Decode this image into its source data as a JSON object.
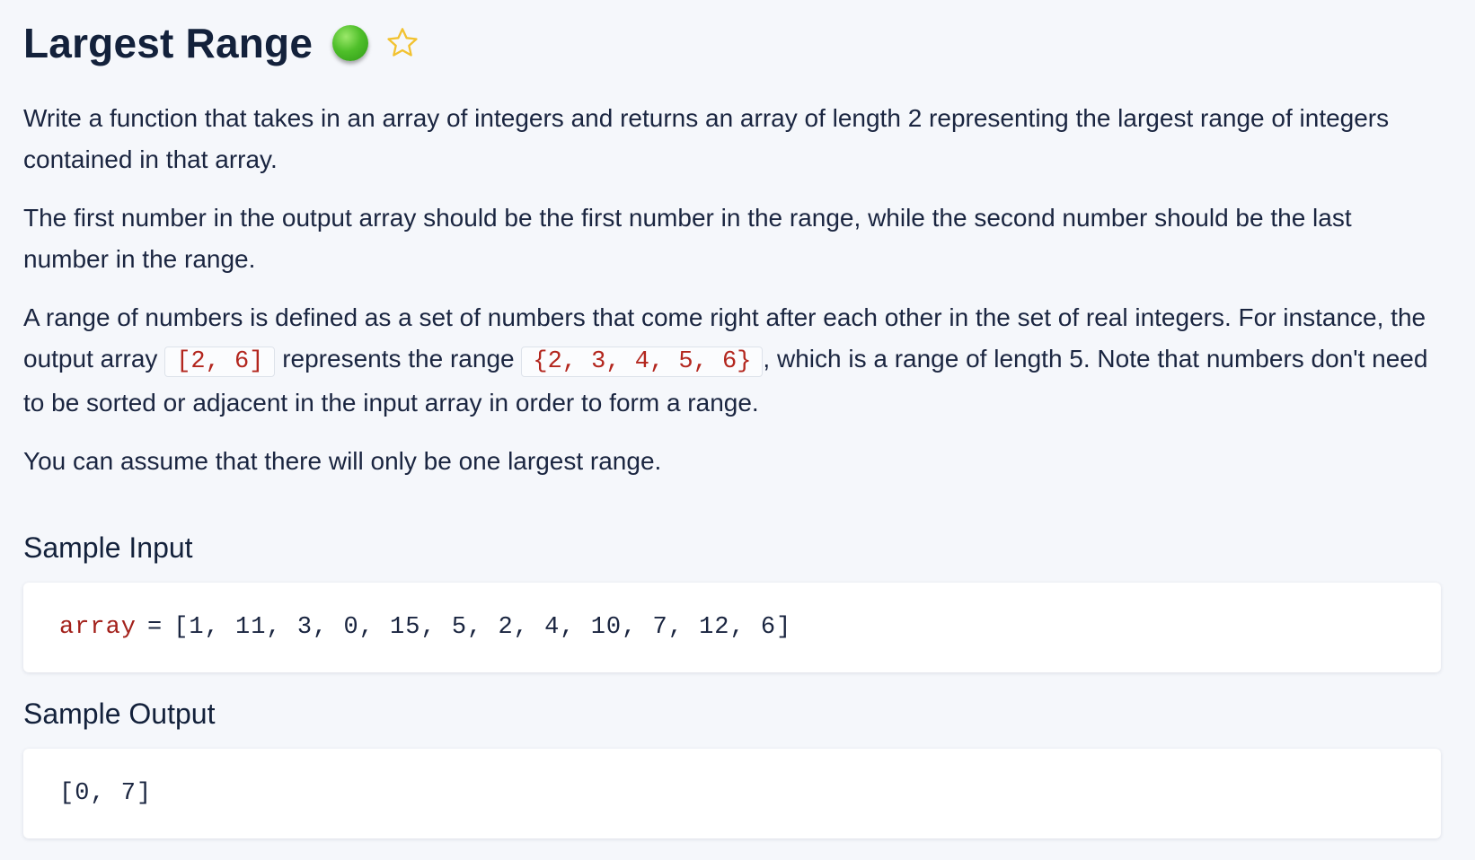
{
  "problem": {
    "title": "Largest Range",
    "difficulty_color": "#4fbf2a",
    "favorite_icon": "star-outline-icon"
  },
  "description": {
    "p1": "Write a function that takes in an array of integers and returns an array of length 2 representing the largest range of integers contained in that array.",
    "p2": "The first number in the output array should be the first number in the range, while the second number should be the last number in the range.",
    "p3_part1": "A range of numbers is defined as a set of numbers that come right after each other in the set of real integers. For instance, the output array ",
    "p3_code1": "[2, 6]",
    "p3_part2": " represents the range ",
    "p3_code2": "{2, 3, 4, 5, 6}",
    "p3_part3": ", which is a range of length 5. Note that numbers don't need to be sorted or adjacent in the input array in order to form a range.",
    "p4": "You can assume that there will only be one largest range."
  },
  "sample_input": {
    "heading": "Sample Input",
    "variable": "array",
    "operator": "=",
    "value": "[1, 11, 3, 0, 15, 5, 2, 4, 10, 7, 12, 6]"
  },
  "sample_output": {
    "heading": "Sample Output",
    "value": "[0, 7]"
  }
}
